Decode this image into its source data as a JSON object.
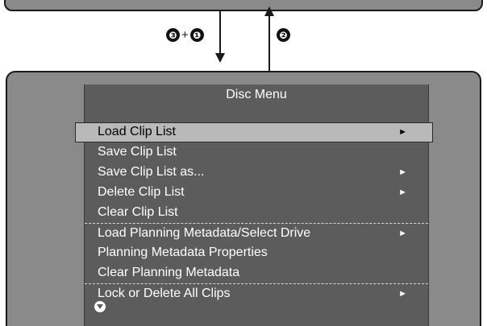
{
  "steps": {
    "down": {
      "first": "❸",
      "plus": "+",
      "second": "❶"
    },
    "up": {
      "label": "❷"
    }
  },
  "menu": {
    "title": "Disc Menu",
    "items": [
      {
        "label": "Load  Clip List",
        "arrow": "►",
        "selected": true
      },
      {
        "label": "Save Clip List",
        "arrow": ""
      },
      {
        "label": "Save Clip List as...",
        "arrow": "►"
      },
      {
        "label": "Delete Clip List",
        "arrow": "►"
      },
      {
        "label": "Clear Clip List",
        "arrow": ""
      },
      {
        "label": "Load Planning Metadata/Select Drive",
        "arrow": "►"
      },
      {
        "label": "Planning Metadata Properties",
        "arrow": ""
      },
      {
        "label": "Clear Planning Metadata",
        "arrow": ""
      },
      {
        "label": "Lock or Delete All Clips",
        "arrow": "►"
      }
    ],
    "scroll_icon": "scroll-down-icon"
  }
}
